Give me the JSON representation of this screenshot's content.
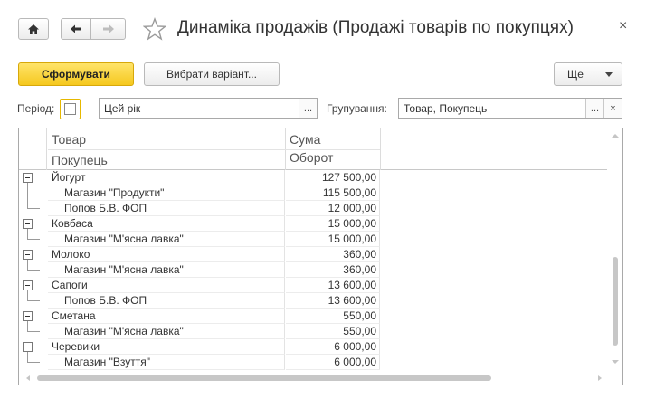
{
  "window": {
    "title": "Динаміка продажів (Продажі товарів по покупцях)",
    "close_glyph": "×",
    "icons": [
      "home-icon",
      "back-arrow-icon",
      "forward-arrow-icon",
      "star-icon",
      "close-icon"
    ]
  },
  "toolbar": {
    "generate_label": "Сформувати",
    "variant_label": "Вибрати варіант...",
    "more_label": "Ще"
  },
  "filters": {
    "period_label": "Період:",
    "period_checked": false,
    "period_value": "Цей рік",
    "period_select_glyph": "...",
    "grouping_label": "Групування:",
    "grouping_value": "Товар, Покупець",
    "grouping_select_glyph": "...",
    "grouping_clear_glyph": "×"
  },
  "table": {
    "headers": {
      "col1_top": "Товар",
      "col1_bottom": "Покупець",
      "col2_top": "Сума",
      "col2_bottom": "Оборот"
    },
    "groups": [
      {
        "name": "Йогурт",
        "amount": "127 500,00",
        "children": [
          {
            "name": "Магазин \"Продукти\"",
            "amount": "115 500,00"
          },
          {
            "name": "Попов Б.В. ФОП",
            "amount": "12 000,00"
          }
        ]
      },
      {
        "name": "Ковбаса",
        "amount": "15 000,00",
        "children": [
          {
            "name": "Магазин \"М'ясна лавка\"",
            "amount": "15 000,00"
          }
        ]
      },
      {
        "name": "Молоко",
        "amount": "360,00",
        "children": [
          {
            "name": "Магазин \"М'ясна лавка\"",
            "amount": "360,00"
          }
        ]
      },
      {
        "name": "Сапоги",
        "amount": "13 600,00",
        "children": [
          {
            "name": "Попов Б.В. ФОП",
            "amount": "13 600,00"
          }
        ]
      },
      {
        "name": "Сметана",
        "amount": "550,00",
        "children": [
          {
            "name": "Магазин \"М'ясна лавка\"",
            "amount": "550,00"
          }
        ]
      },
      {
        "name": "Черевики",
        "amount": "6 000,00",
        "children": [
          {
            "name": "Магазин \"Взуття\"",
            "amount": "6 000,00"
          }
        ]
      }
    ]
  }
}
